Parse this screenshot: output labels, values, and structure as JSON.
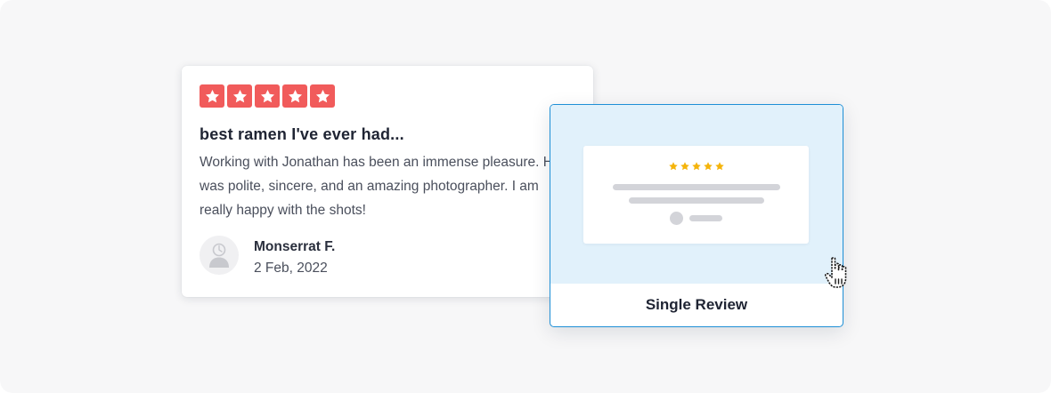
{
  "review": {
    "rating": 5,
    "rating_max": 5,
    "title": "best ramen I've ever had...",
    "body": "Working with Jonathan has been an immense pleasure. He\nwas polite, sincere, and an amazing photographer. I am\nreally happy with the shots!",
    "author_name": "Monserrat F.",
    "date": "2 Feb, 2022",
    "star_color": "#f15b5b",
    "avatar_icon": "user-placeholder-icon"
  },
  "widget_option": {
    "label": "Single Review",
    "selected": true,
    "accent_color": "#1e8fd6",
    "preview_background": "#e1f1fb",
    "preview_star_color": "#f5b40a",
    "preview_star_count": 5
  },
  "cursor": {
    "icon": "hand-pointer-icon"
  }
}
